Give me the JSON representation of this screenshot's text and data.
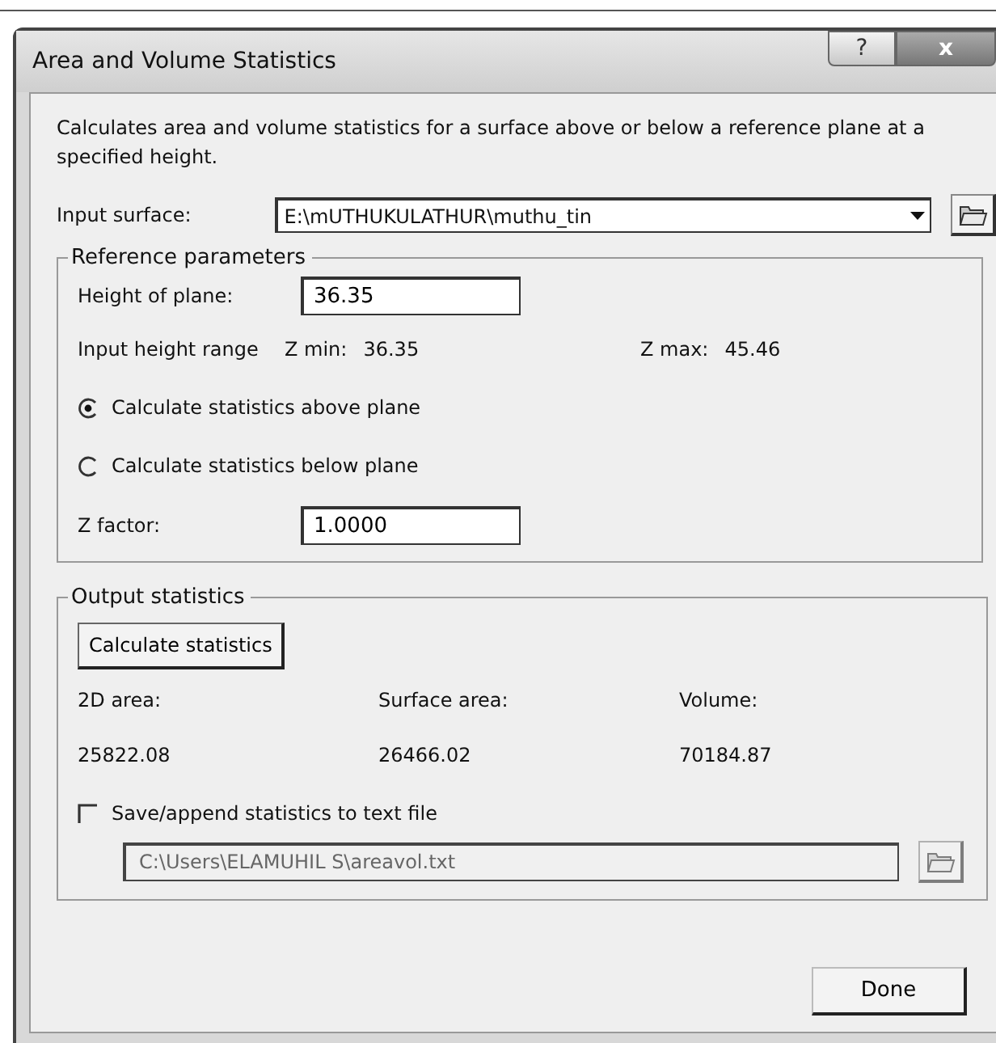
{
  "window": {
    "title": "Area and Volume Statistics",
    "help_button": "?",
    "close_button": "x"
  },
  "description": "Calculates area and volume statistics for a surface above or below a reference plane at a specified height.",
  "input_surface": {
    "label": "Input surface:",
    "value": "E:\\mUTHUKULATHUR\\muthu_tin"
  },
  "reference_parameters": {
    "title": "Reference parameters",
    "height_of_plane": {
      "label": "Height of plane:",
      "value": "36.35"
    },
    "height_range": {
      "label": "Input height range",
      "z_min_label": "Z min:",
      "z_min": "36.35",
      "z_max_label": "Z max:",
      "z_max": "45.46"
    },
    "options": [
      {
        "label": "Calculate statistics above plane",
        "selected": true
      },
      {
        "label": "Calculate statistics below plane",
        "selected": false
      }
    ],
    "z_factor": {
      "label": "Z factor:",
      "value": "1.0000"
    }
  },
  "output_statistics": {
    "title": "Output statistics",
    "calculate_button": "Calculate statistics",
    "results": [
      {
        "label": "2D area:",
        "value": "25822.08"
      },
      {
        "label": "Surface area:",
        "value": "26466.02"
      },
      {
        "label": "Volume:",
        "value": "70184.87"
      }
    ],
    "save": {
      "label": "Save/append statistics to text file",
      "checked": false
    },
    "output_file": {
      "value": "C:\\Users\\ELAMUHIL S\\areavol.txt",
      "disabled": true
    }
  },
  "buttons": [
    "Done"
  ]
}
